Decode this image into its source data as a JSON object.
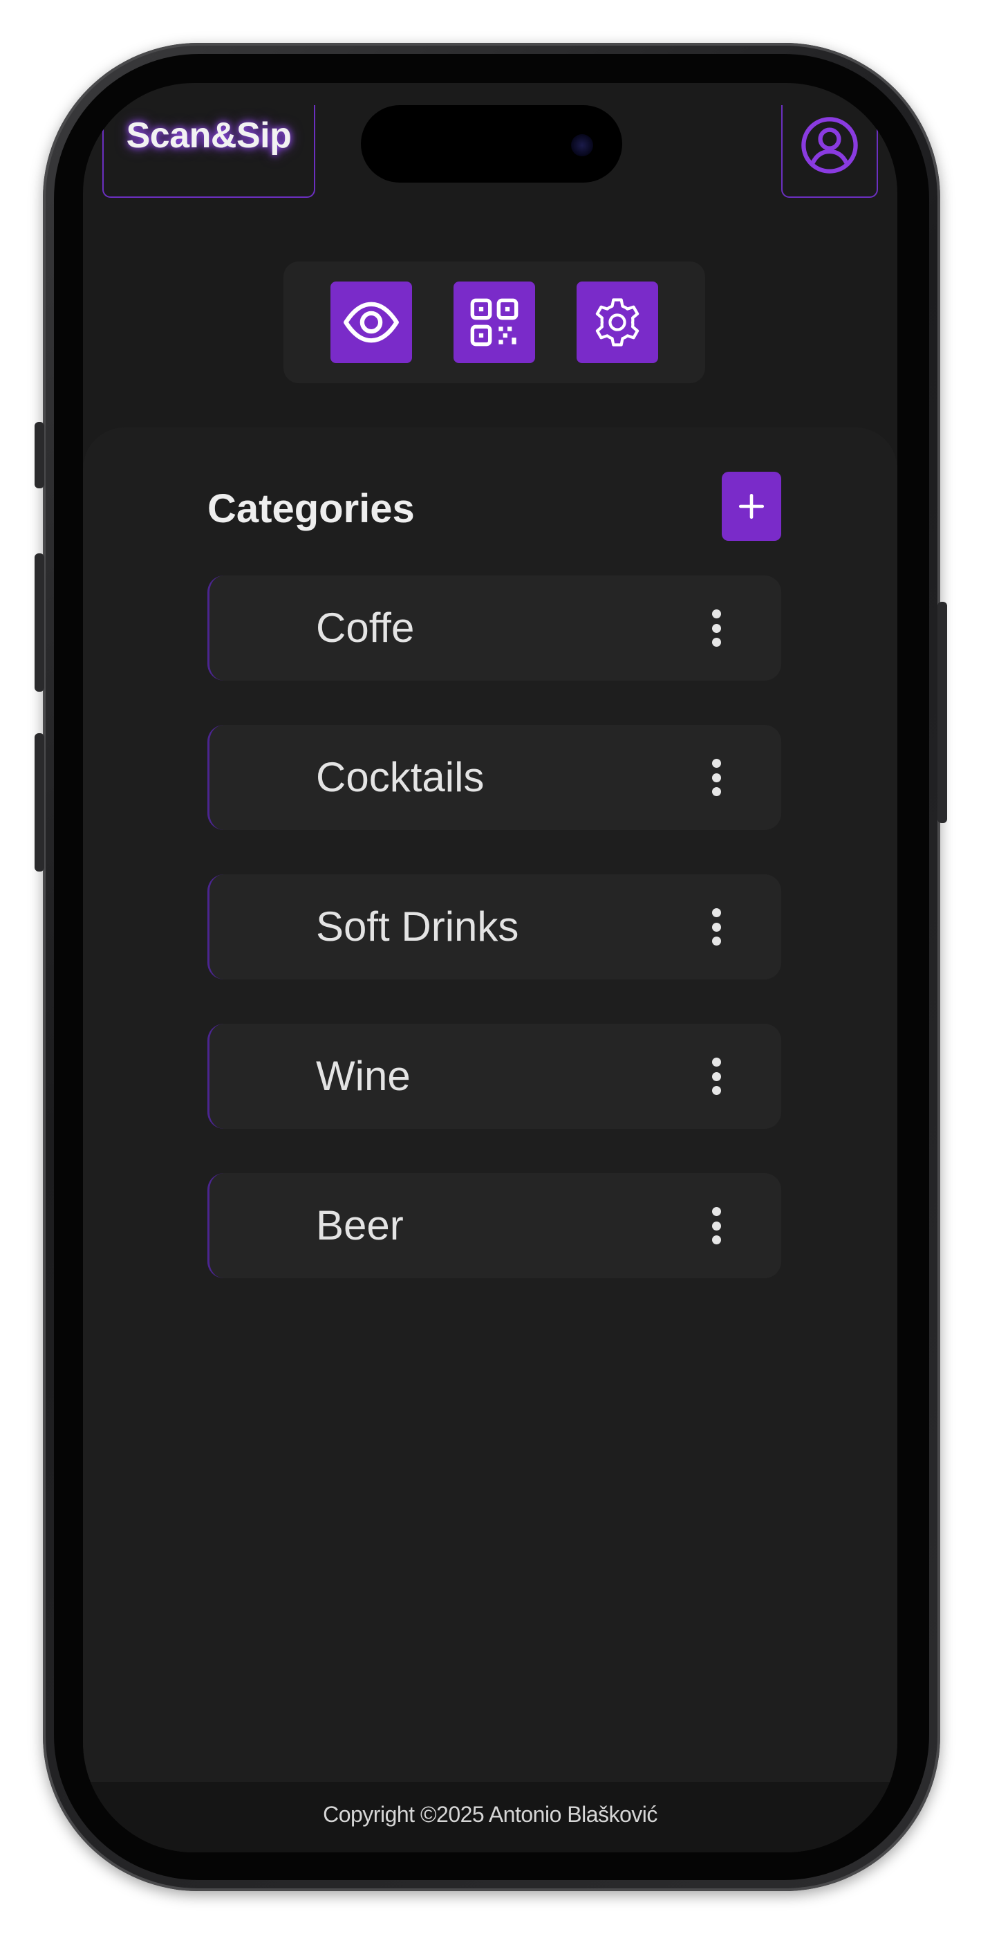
{
  "header": {
    "brand": "Scan&Sip",
    "profile_icon": "user-circle-icon"
  },
  "toolbar": {
    "items": [
      {
        "icon": "eye-icon",
        "label": "preview"
      },
      {
        "icon": "qr-code-icon",
        "label": "qr code"
      },
      {
        "icon": "gear-icon",
        "label": "settings"
      }
    ]
  },
  "main": {
    "title": "Categories",
    "add_icon": "plus-icon",
    "categories": [
      {
        "label": "Coffe"
      },
      {
        "label": "Cocktails"
      },
      {
        "label": "Soft Drinks"
      },
      {
        "label": "Wine"
      },
      {
        "label": "Beer"
      }
    ]
  },
  "footer": {
    "copyright": "Copyright ©2025 Antonio Blašković"
  },
  "colors": {
    "accent": "#7a2bc9",
    "background": "#1b1b1b",
    "panel": "#1e1e1e",
    "card": "#252525",
    "text": "#e4e4e4"
  }
}
